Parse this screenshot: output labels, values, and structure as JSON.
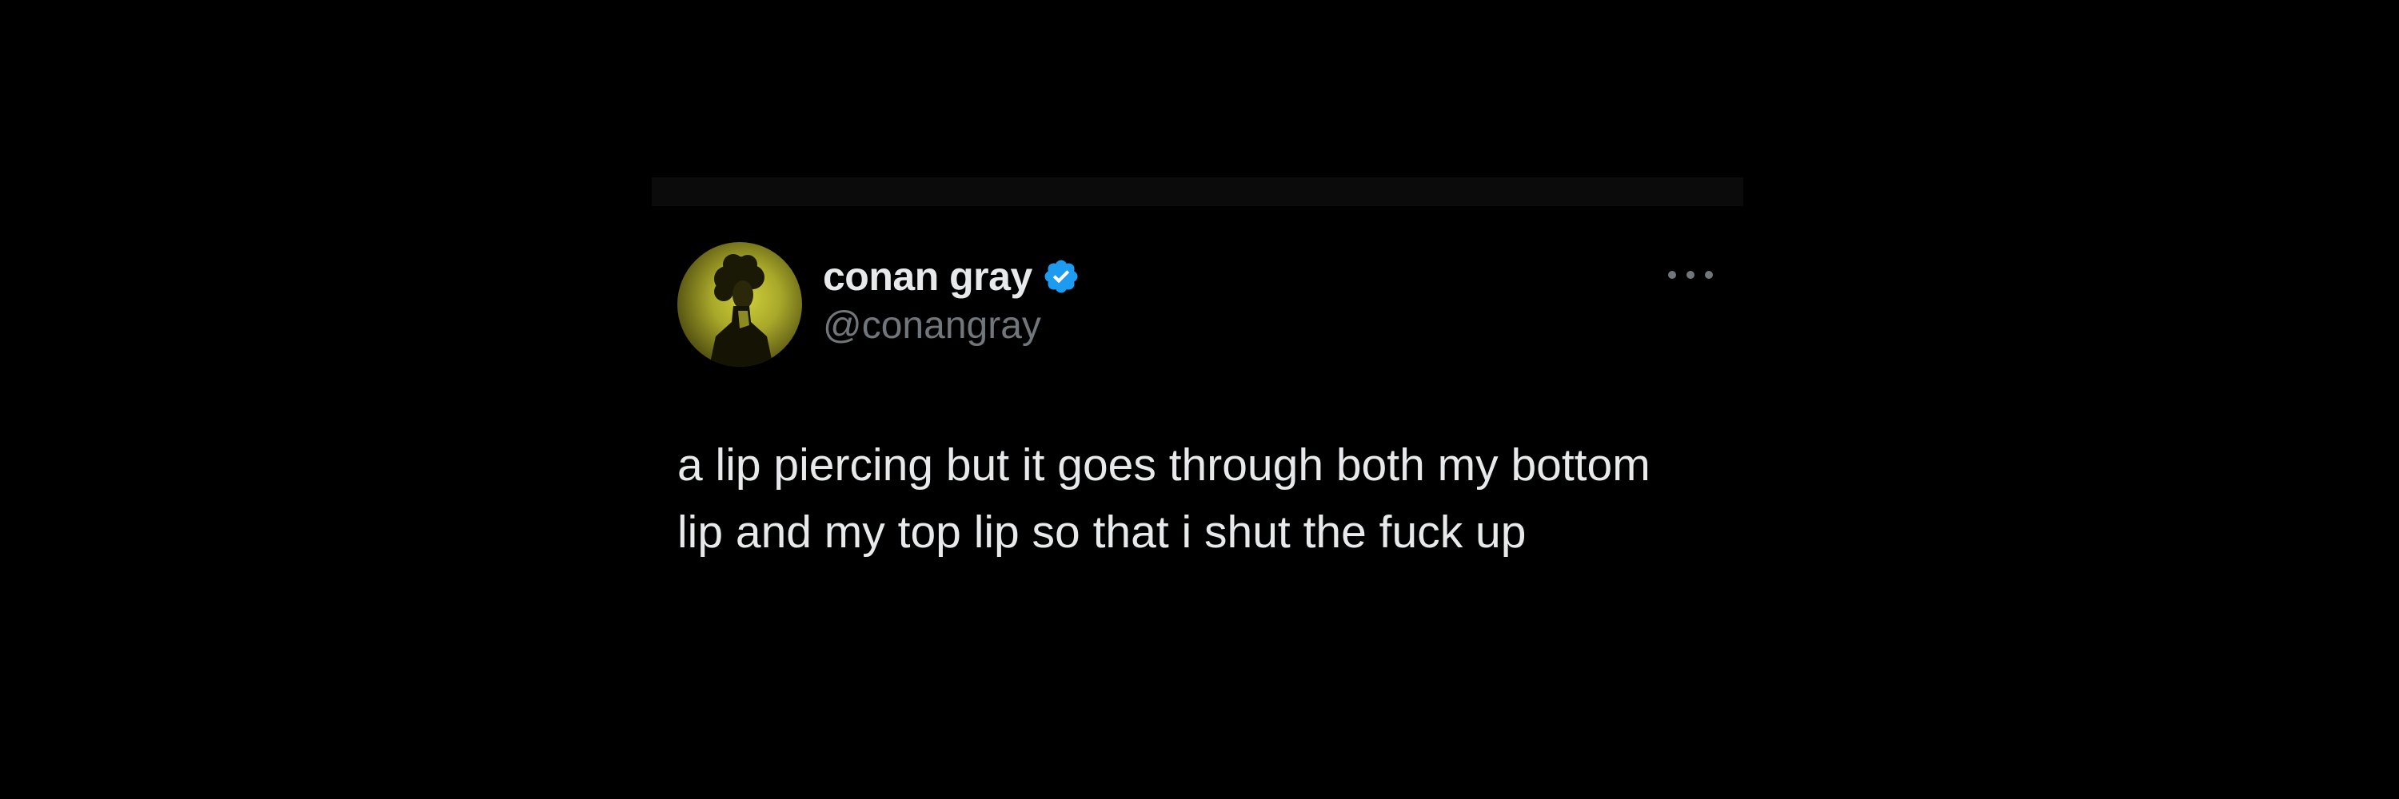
{
  "tweet": {
    "author": {
      "display_name": "conan gray",
      "handle": "@conangray",
      "verified": true,
      "avatar_icon": "profile-avatar",
      "verified_icon": "verified-badge-icon"
    },
    "text_lines": [
      "a lip piercing but it goes through both my bottom",
      "lip and my top lip so that i shut the fuck up"
    ],
    "more_icon": "more-dots-icon"
  },
  "colors": {
    "background": "#000000",
    "text_primary": "#e7e9ea",
    "text_secondary": "#71767b",
    "verified": "#1d9bf0",
    "avatar_tint": "#c9c93a"
  }
}
